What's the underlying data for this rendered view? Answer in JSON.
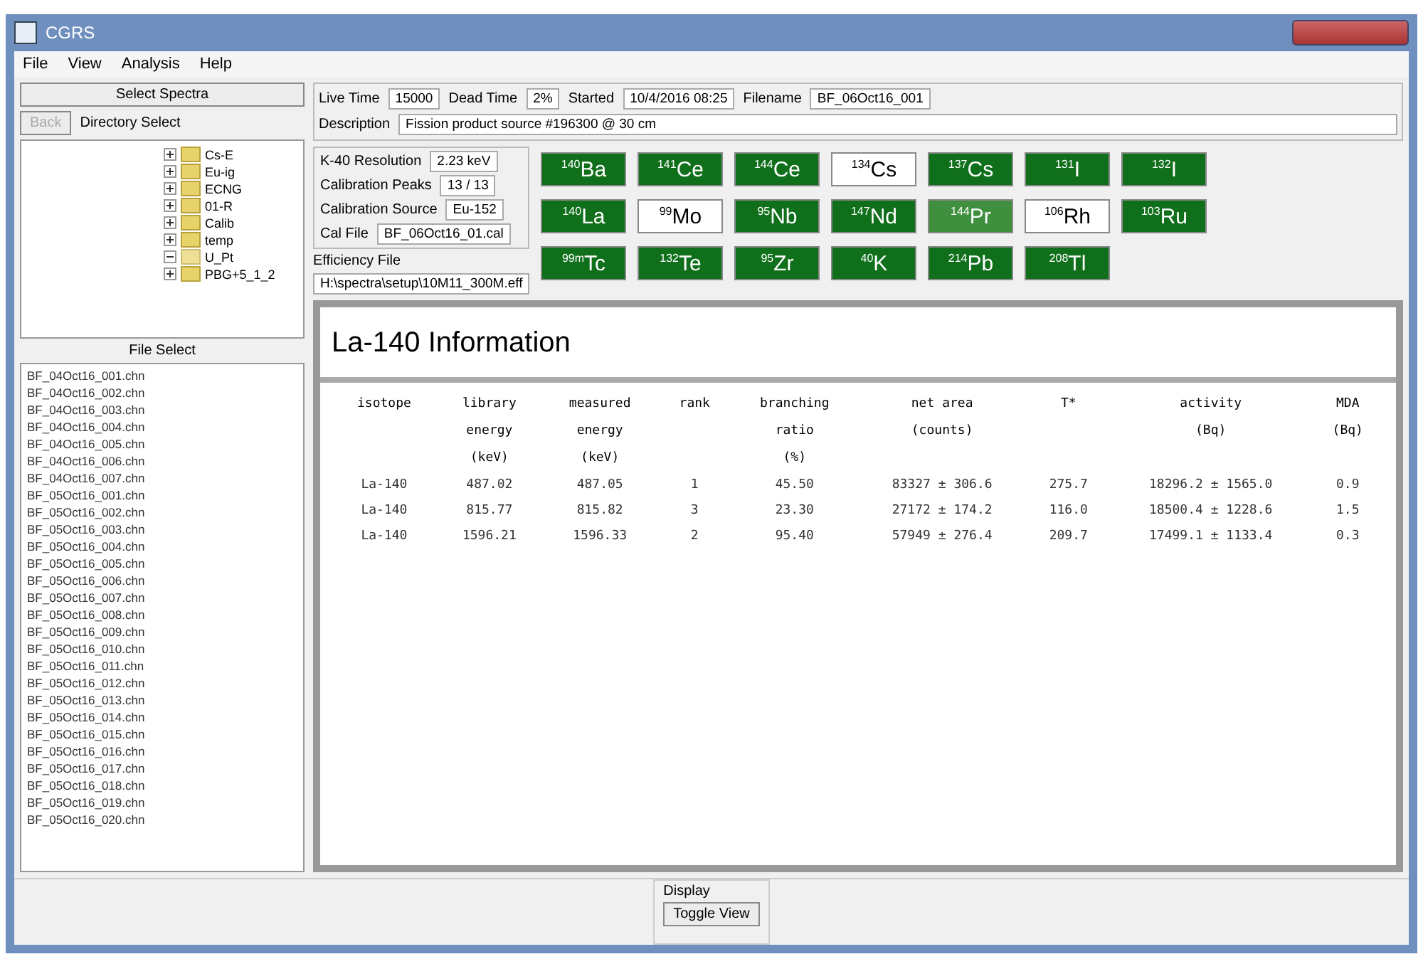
{
  "window": {
    "title": "CGRS"
  },
  "menu": [
    "File",
    "View",
    "Analysis",
    "Help"
  ],
  "left": {
    "select_button": "Select Spectra",
    "dir_button": {
      "label": "Back",
      "disabled": true
    },
    "dir_label": "Directory Select",
    "tree": [
      {
        "label": "Cs-E",
        "expanded": false
      },
      {
        "label": "Eu-ig",
        "expanded": false
      },
      {
        "label": "ECNG",
        "expanded": false
      },
      {
        "label": "01-R",
        "expanded": false
      },
      {
        "label": "Calib",
        "expanded": false
      },
      {
        "label": "temp",
        "expanded": false
      },
      {
        "label": "U_Pt",
        "expanded": true
      }
    ],
    "tree_last": {
      "label": "PBG+5_1_2",
      "expanded": false
    },
    "file_label": "File Select",
    "files": [
      "BF_04Oct16_001.chn",
      "BF_04Oct16_002.chn",
      "BF_04Oct16_003.chn",
      "BF_04Oct16_004.chn",
      "BF_04Oct16_005.chn",
      "BF_04Oct16_006.chn",
      "BF_04Oct16_007.chn",
      "BF_05Oct16_001.chn",
      "BF_05Oct16_002.chn",
      "BF_05Oct16_003.chn",
      "BF_05Oct16_004.chn",
      "BF_05Oct16_005.chn",
      "BF_05Oct16_006.chn",
      "BF_05Oct16_007.chn",
      "BF_05Oct16_008.chn",
      "BF_05Oct16_009.chn",
      "BF_05Oct16_010.chn",
      "BF_05Oct16_011.chn",
      "BF_05Oct16_012.chn",
      "BF_05Oct16_013.chn",
      "BF_05Oct16_014.chn",
      "BF_05Oct16_015.chn",
      "BF_05Oct16_016.chn",
      "BF_05Oct16_017.chn",
      "BF_05Oct16_018.chn",
      "BF_05Oct16_019.chn",
      "BF_05Oct16_020.chn"
    ]
  },
  "header": {
    "fields": [
      {
        "label": "Live Time",
        "value": "15000"
      },
      {
        "label": "Dead Time",
        "value": "2%"
      },
      {
        "label": "Started",
        "value": "10/4/2016 08:25"
      },
      {
        "label": "Filename",
        "value": "BF_06Oct16_001"
      }
    ],
    "description": {
      "label": "Description",
      "value": "Fission product source #196300 @ 30 cm"
    },
    "calibration": [
      {
        "label": "K-40 Resolution",
        "value": "2.23 keV"
      },
      {
        "label": "Calibration Peaks",
        "value": "13 / 13"
      },
      {
        "label": "Calibration Source",
        "value": "Eu-152"
      },
      {
        "label": "Cal File",
        "value": "BF_06Oct16_01.cal"
      }
    ],
    "efficiency": {
      "label": "Efficiency File",
      "value": "H:\\spectra\\setup\\10M11_300M.eff"
    }
  },
  "isotopes": [
    {
      "label": "$^{140}$Ba",
      "found": true,
      "hovered": false
    },
    {
      "label": "$^{141}$Ce",
      "found": true,
      "hovered": false
    },
    {
      "label": "$^{144}$Ce",
      "found": true,
      "hovered": false
    },
    {
      "label": "$^{134}$Cs",
      "found": false,
      "hovered": false
    },
    {
      "label": "$^{137}$Cs",
      "found": true,
      "hovered": false
    },
    {
      "label": "$^{131}$I",
      "found": true,
      "hovered": false
    },
    {
      "label": "$^{132}$I",
      "found": true,
      "hovered": false
    },
    {
      "label": "$^{140}$La",
      "found": true,
      "hovered": false
    },
    {
      "label": "$^{99}$Mo",
      "found": false,
      "hovered": false
    },
    {
      "label": "$^{95}$Nb",
      "found": true,
      "hovered": false
    },
    {
      "label": "$^{147}$Nd",
      "found": true,
      "hovered": false
    },
    {
      "label": "$^{144}$Pr",
      "found": true,
      "hovered": true
    },
    {
      "label": "$^{106}$Rh",
      "found": false,
      "hovered": false
    },
    {
      "label": "$^{103}$Ru",
      "found": true,
      "hovered": false
    },
    {
      "label": "$^{99m}$Tc",
      "found": true,
      "hovered": false
    },
    {
      "label": "$^{132}$Te",
      "found": true,
      "hovered": false
    },
    {
      "label": "$^{95}$Zr",
      "found": true,
      "hovered": false
    },
    {
      "label": "$^{40}$K",
      "found": true,
      "hovered": false
    },
    {
      "label": "$^{214}$Pb",
      "found": true,
      "hovered": false
    },
    {
      "label": "$^{208}$Tl",
      "found": true,
      "hovered": false
    }
  ],
  "info": {
    "title": "La-140 Information",
    "header_rows": [
      [
        "isotope",
        "library",
        "measured",
        "rank",
        "branching",
        "net area",
        "T*",
        "activity",
        "MDA"
      ],
      [
        null,
        "energy",
        "energy",
        null,
        "ratio",
        "(counts)",
        null,
        "(Bq)",
        "(Bq)"
      ],
      [
        null,
        "(keV)",
        "(keV)",
        null,
        "(%)",
        null,
        null,
        null,
        null
      ]
    ],
    "rows": [
      [
        "La-140",
        "487.02",
        "487.05",
        "1",
        "45.50",
        "83327 ± 306.6",
        "275.7",
        "18296.2 ± 1565.0",
        "0.9"
      ],
      [
        "La-140",
        "815.77",
        "815.82",
        "3",
        "23.30",
        "27172 ± 174.2",
        "116.0",
        "18500.4 ± 1228.6",
        "1.5"
      ],
      [
        "La-140",
        "1596.21",
        "1596.33",
        "2",
        "95.40",
        "57949 ± 276.4",
        "209.7",
        "17499.1 ± 1133.4",
        "0.3"
      ]
    ]
  },
  "display": {
    "label": "Display",
    "button": "Toggle View"
  }
}
